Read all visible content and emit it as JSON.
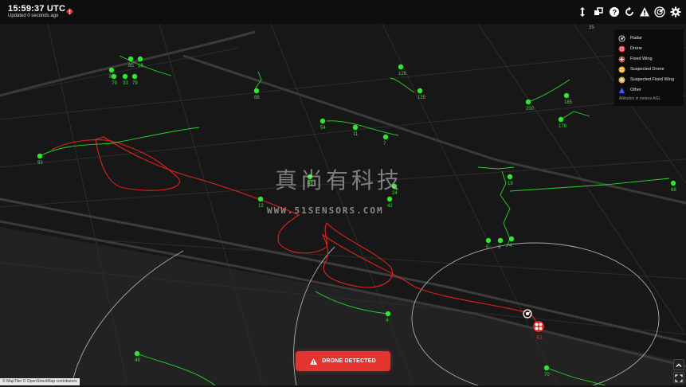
{
  "header": {
    "time": "15:59:37 UTC",
    "updated": "Updated 0 seconds ago"
  },
  "toolbar": {
    "icons": [
      "vertical-arrows-icon",
      "layers-icon",
      "help-icon",
      "refresh-icon",
      "warning-icon",
      "radar-icon",
      "settings-icon"
    ]
  },
  "legend": {
    "items": [
      {
        "label": "Radar",
        "icon": "radar-icon",
        "color": "#dddddd"
      },
      {
        "label": "Drone",
        "icon": "drone-icon",
        "color": "#e53935"
      },
      {
        "label": "Fixed Wing",
        "icon": "fixed-wing-icon",
        "color": "#e53935"
      },
      {
        "label": "Suspected Drone",
        "icon": "suspected-drone-icon",
        "color": "#f5a623"
      },
      {
        "label": "Suspected Fixed Wing",
        "icon": "suspected-fixed-wing-icon",
        "color": "#f5a623"
      },
      {
        "label": "Other",
        "icon": "other-triangle-icon",
        "color": "#3b5bff"
      }
    ],
    "note": "Altitudes in meters AGL"
  },
  "alert": {
    "label": "DRONE DETECTED"
  },
  "watermark": {
    "cn": "真尚有科技",
    "url": "WWW.51SENSORS.COM"
  },
  "attribution": "© MapTiler © OpenStreetMap contributors",
  "drone": {
    "altitude": "43"
  },
  "tracks": [
    {
      "label": "35"
    },
    {
      "label": "69"
    },
    {
      "label": "85"
    },
    {
      "label": "18"
    },
    {
      "label": "79"
    },
    {
      "label": "33"
    },
    {
      "label": "79"
    },
    {
      "label": "126"
    },
    {
      "label": "135"
    },
    {
      "label": "88"
    },
    {
      "label": "200"
    },
    {
      "label": "185"
    },
    {
      "label": "178"
    },
    {
      "label": "54"
    },
    {
      "label": "11"
    },
    {
      "label": "7"
    },
    {
      "label": "93"
    },
    {
      "label": "12"
    },
    {
      "label": "48"
    },
    {
      "label": "24"
    },
    {
      "label": "42"
    },
    {
      "label": "19"
    },
    {
      "label": "68"
    },
    {
      "label": "5"
    },
    {
      "label": "4"
    },
    {
      "label": "3"
    },
    {
      "label": "4"
    },
    {
      "label": "49"
    },
    {
      "label": "70"
    }
  ],
  "colors": {
    "track": "#2ee82e",
    "drone_path": "#e0221c",
    "alert": "#e3342f"
  }
}
